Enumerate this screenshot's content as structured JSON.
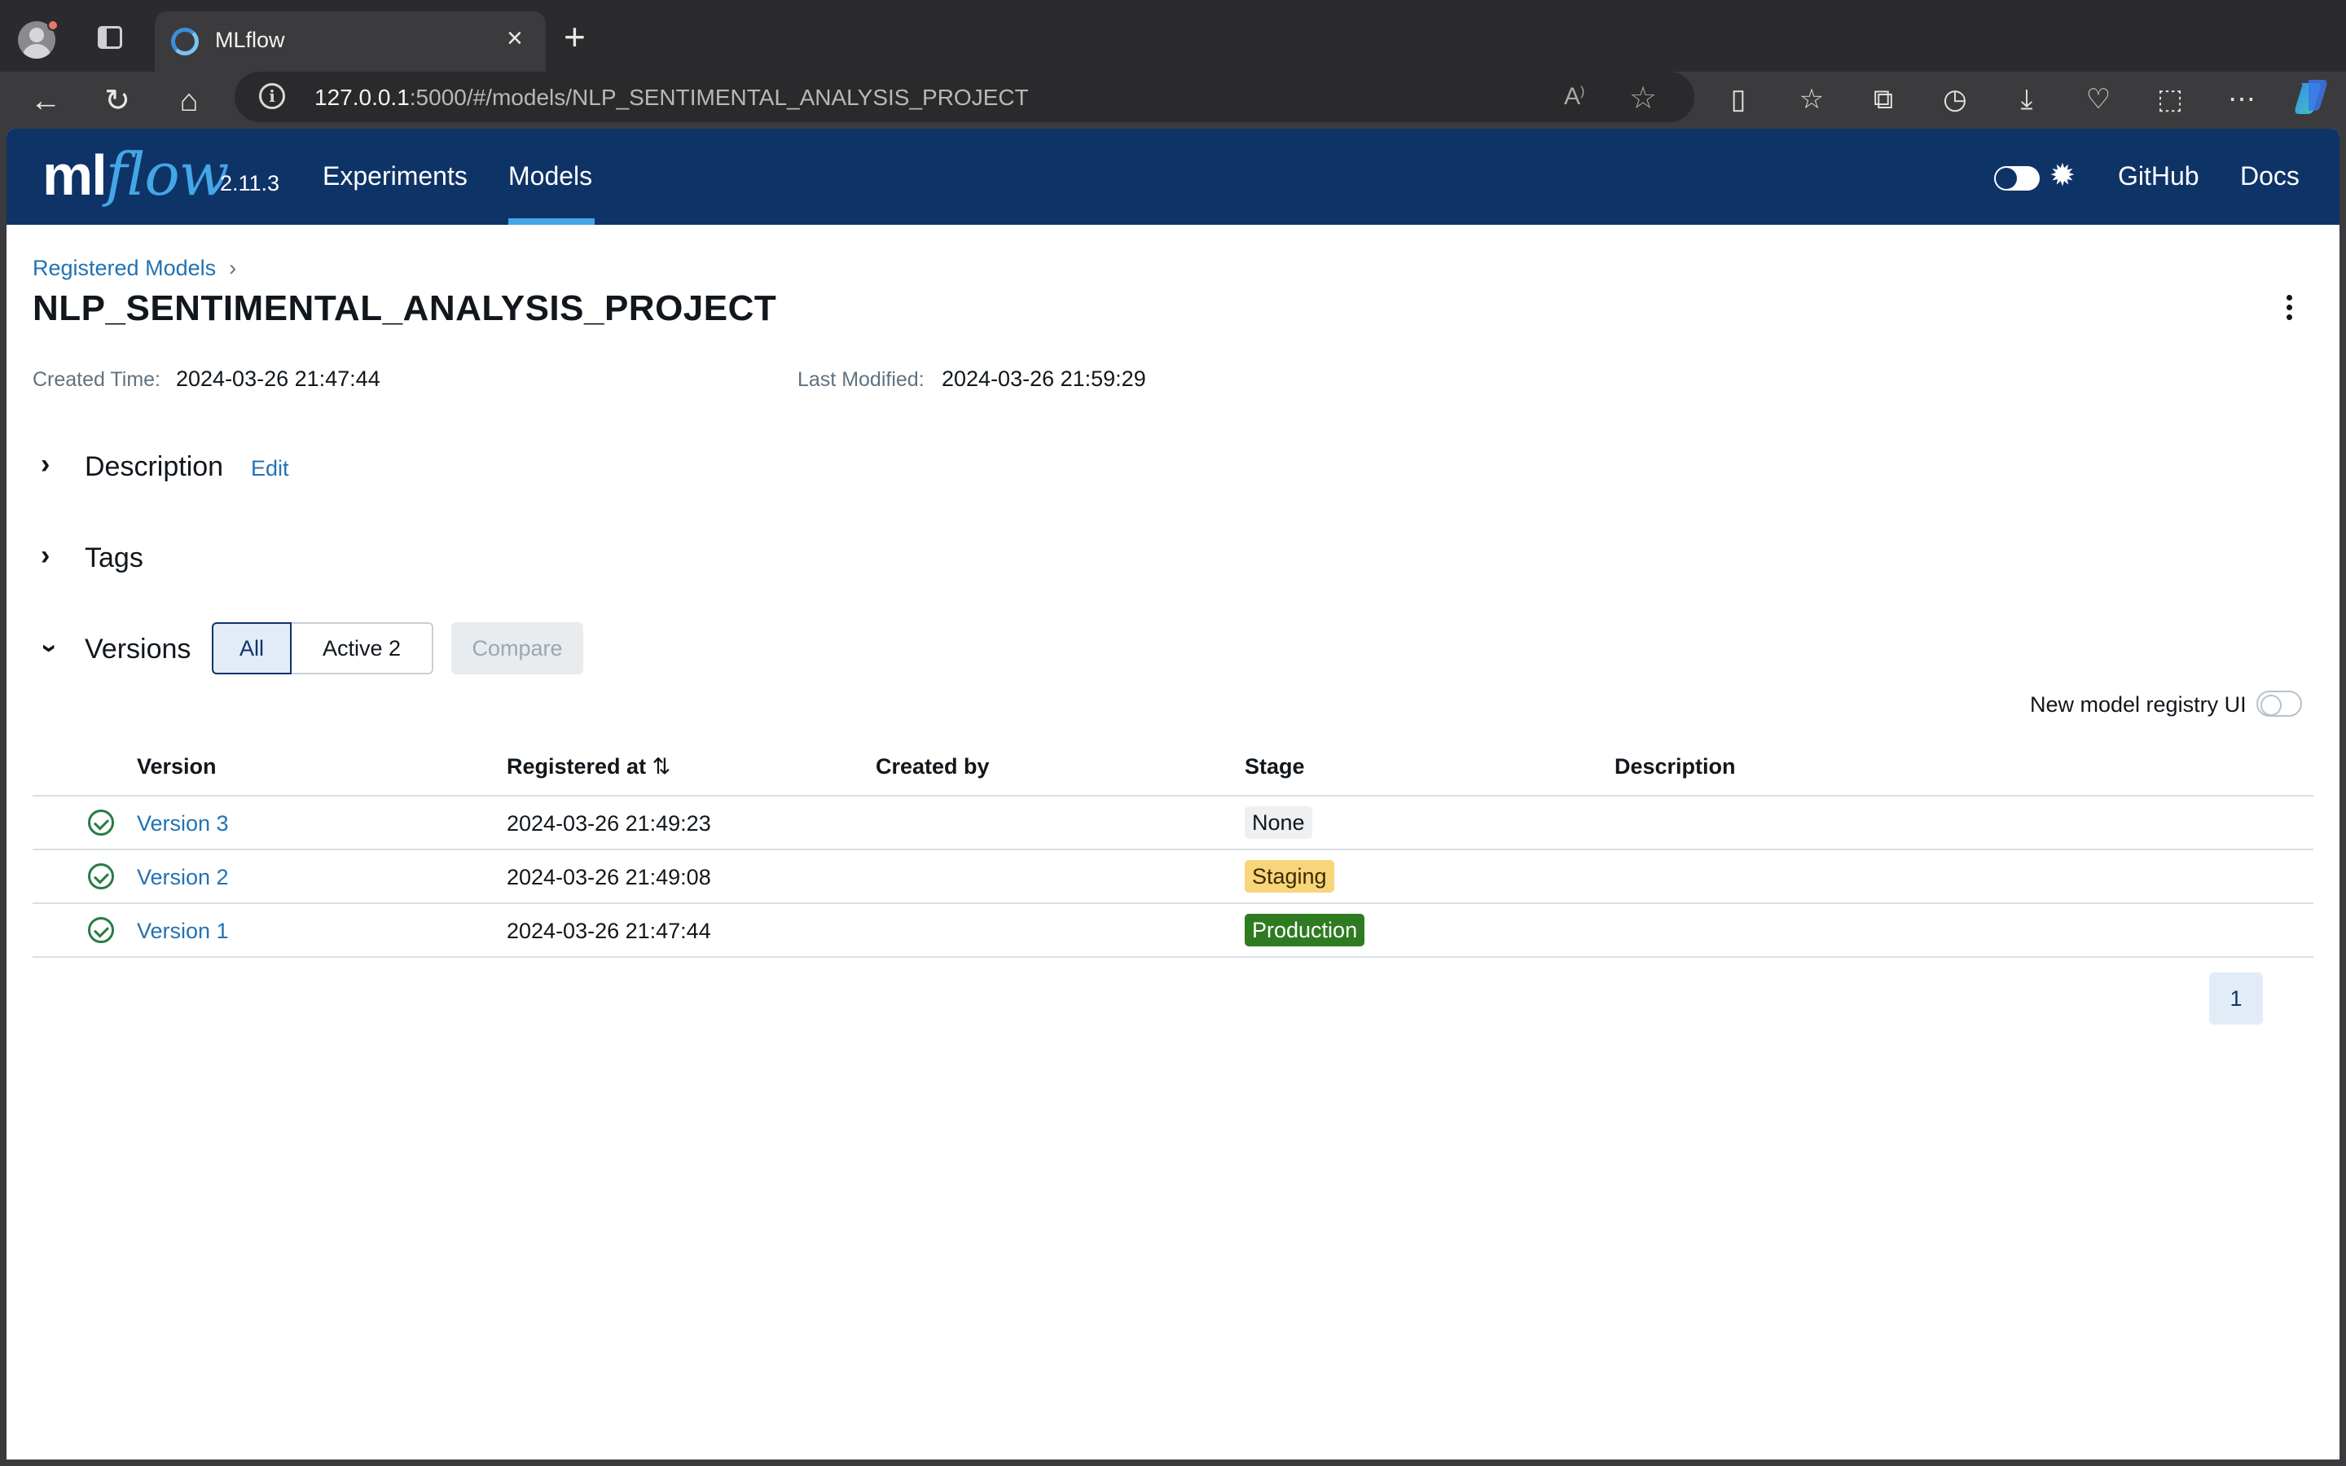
{
  "browser": {
    "tab_title": "MLflow",
    "url_host": "127.0.0.1",
    "url_rest": ":5000/#/models/NLP_SENTIMENTAL_ANALYSIS_PROJECT"
  },
  "header": {
    "logo_ml": "ml",
    "logo_flow": "flow",
    "version": "2.11.3",
    "nav": [
      {
        "label": "Experiments",
        "active": false
      },
      {
        "label": "Models",
        "active": true
      }
    ],
    "links": [
      "GitHub",
      "Docs"
    ]
  },
  "breadcrumb": {
    "label": "Registered Models",
    "separator": "›"
  },
  "model": {
    "name": "NLP_SENTIMENTAL_ANALYSIS_PROJECT",
    "created_label": "Created Time:",
    "created_value": "2024-03-26 21:47:44",
    "modified_label": "Last Modified:",
    "modified_value": "2024-03-26 21:59:29"
  },
  "sections": {
    "description": "Description",
    "edit": "Edit",
    "tags": "Tags",
    "versions": "Versions"
  },
  "versions_toolbar": {
    "filter_all": "All",
    "filter_active": "Active 2",
    "compare": "Compare",
    "registry_toggle_label": "New model registry UI"
  },
  "table": {
    "columns": [
      "Version",
      "Registered at",
      "Created by",
      "Stage",
      "Description"
    ],
    "rows": [
      {
        "version": "Version 3",
        "registered_at": "2024-03-26 21:49:23",
        "created_by": "",
        "stage": "None",
        "description": ""
      },
      {
        "version": "Version 2",
        "registered_at": "2024-03-26 21:49:08",
        "created_by": "",
        "stage": "Staging",
        "description": ""
      },
      {
        "version": "Version 1",
        "registered_at": "2024-03-26 21:47:44",
        "created_by": "",
        "stage": "Production",
        "description": ""
      }
    ]
  },
  "pagination": {
    "current_page": "1"
  },
  "colors": {
    "header_bg": "#0e3367",
    "link": "#2272b4",
    "staging": "#f8d57a",
    "production": "#2f7b21"
  }
}
